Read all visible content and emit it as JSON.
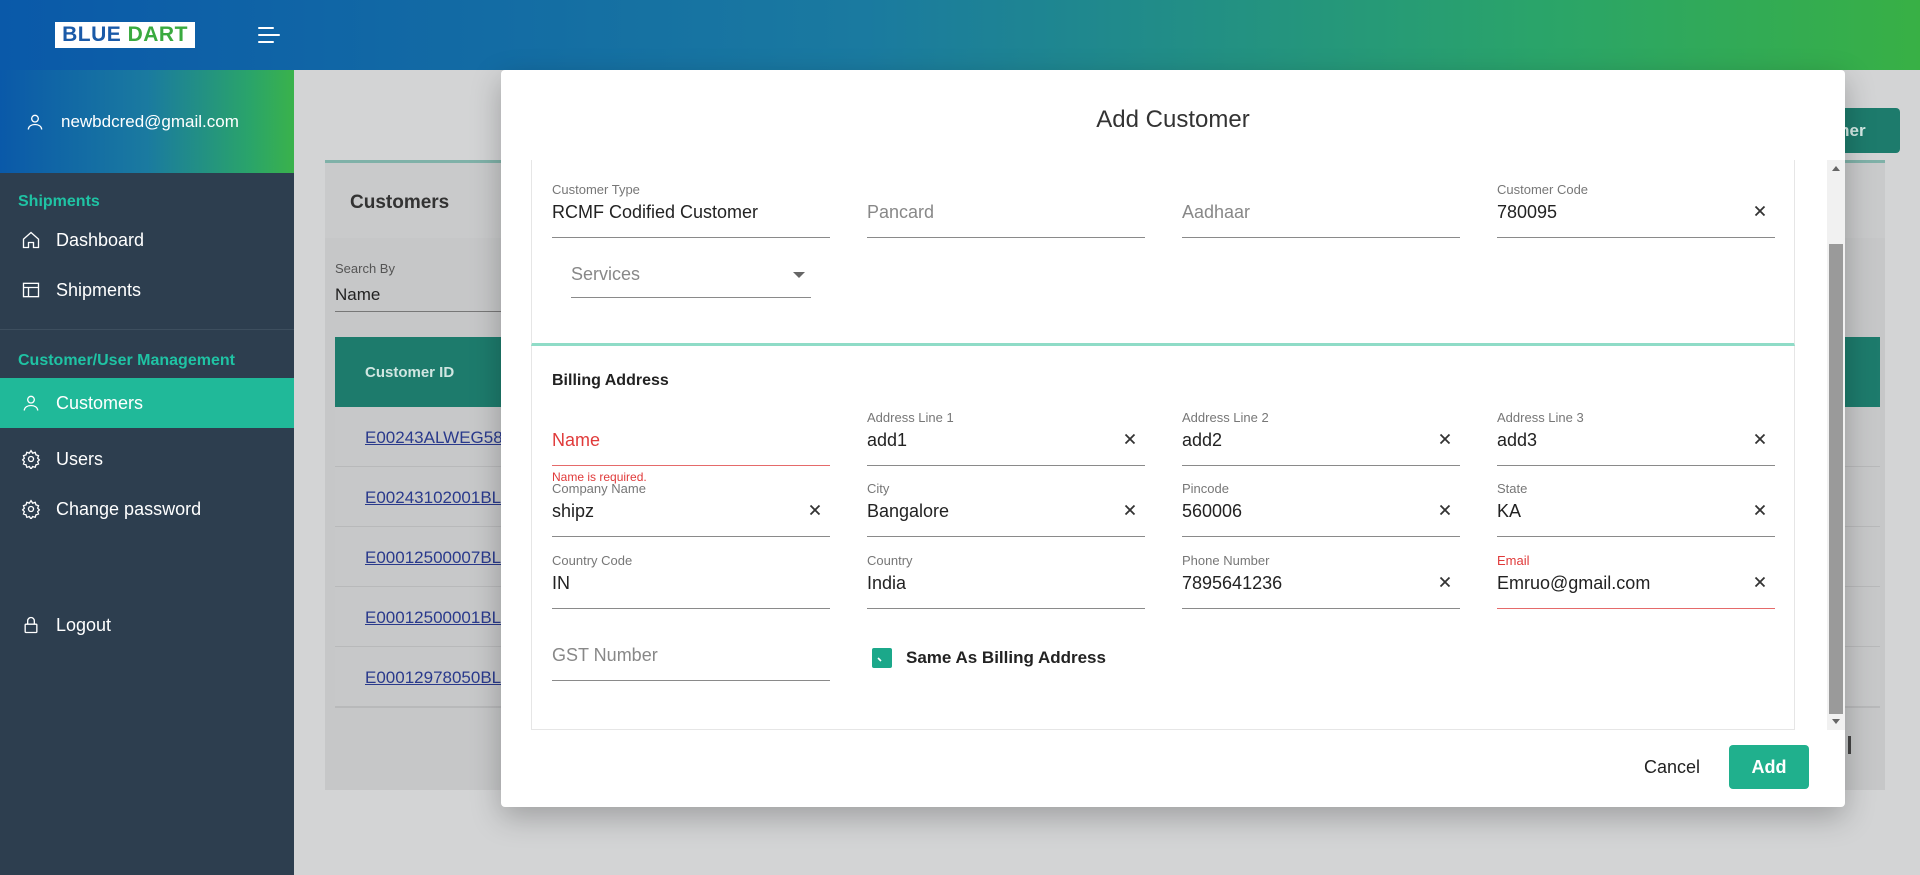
{
  "brand": {
    "logo_blue": "BLUE",
    "logo_green": "DART"
  },
  "sidebar": {
    "user_email": "newbdcred@gmail.com",
    "section_shipments": "Shipments",
    "items_shipments": [
      {
        "label": "Dashboard",
        "icon": "home-icon"
      },
      {
        "label": "Shipments",
        "icon": "table-icon"
      }
    ],
    "section_management": "Customer/User Management",
    "items_management": [
      {
        "label": "Customers",
        "icon": "user-icon",
        "active": true
      },
      {
        "label": "Users",
        "icon": "gear-icon"
      },
      {
        "label": "Change password",
        "icon": "gear-icon"
      }
    ],
    "logout": "Logout"
  },
  "background_page": {
    "title": "Customers",
    "add_button_partial": "omer",
    "search_by_label": "Search By",
    "search_by_value": "Name",
    "table_header": "Customer ID",
    "customer_ids": [
      "E00243ALWEG58",
      "E00243102001BL",
      "E00012500007BL",
      "E00012500001BL",
      "E00012978050BL"
    ]
  },
  "modal": {
    "title": "Add Customer",
    "customer_type": {
      "label": "Customer Type",
      "value": "RCMF Codified Customer"
    },
    "pancard": {
      "placeholder": "Pancard"
    },
    "aadhaar": {
      "placeholder": "Aadhaar"
    },
    "customer_code": {
      "label": "Customer Code",
      "value": "780095"
    },
    "services": {
      "placeholder": "Services"
    },
    "billing_title": "Billing Address",
    "name": {
      "placeholder": "Name",
      "error": "Name is required."
    },
    "address1": {
      "label": "Address Line 1",
      "value": "add1"
    },
    "address2": {
      "label": "Address Line 2",
      "value": "add2"
    },
    "address3": {
      "label": "Address Line 3",
      "value": "add3"
    },
    "company_name": {
      "label": "Company Name",
      "value": "shipz"
    },
    "city": {
      "label": "City",
      "value": "Bangalore"
    },
    "pincode": {
      "label": "Pincode",
      "value": "560006"
    },
    "state": {
      "label": "State",
      "value": "KA"
    },
    "country_code": {
      "label": "Country Code",
      "value": "IN"
    },
    "country": {
      "label": "Country",
      "value": "India"
    },
    "phone": {
      "label": "Phone Number",
      "value": "7895641236"
    },
    "email": {
      "label": "Email",
      "value": "Emruo@gmail.com"
    },
    "gst": {
      "placeholder": "GST Number"
    },
    "same_as_billing": "Same As Billing Address",
    "cancel": "Cancel",
    "add": "Add"
  },
  "colors": {
    "accent": "#20b999",
    "sidebar_bg": "#2d3e4f",
    "error": "#e03a3a"
  }
}
